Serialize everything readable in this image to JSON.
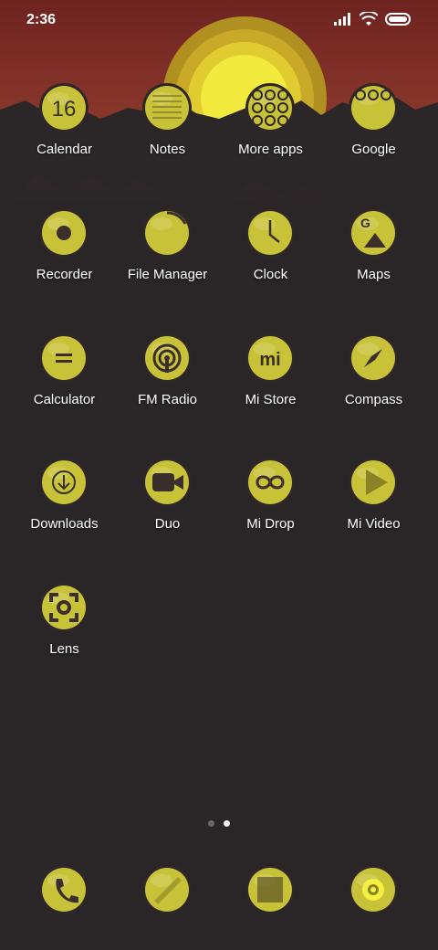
{
  "status": {
    "time": "2:36",
    "icons": [
      "signal-icon",
      "wifi-icon",
      "battery-icon"
    ]
  },
  "colors": {
    "accent": "#e8e640",
    "icon_fill": "#c8c238",
    "background": "#2a2527",
    "sky": "#8a2f2a"
  },
  "apps": [
    {
      "label": "Calendar",
      "icon": "calendar-icon",
      "text": "16"
    },
    {
      "label": "Notes",
      "icon": "notes-icon"
    },
    {
      "label": "More apps",
      "icon": "folder-icon"
    },
    {
      "label": "Google",
      "icon": "google-folder-icon"
    },
    {
      "label": "Recorder",
      "icon": "recorder-icon"
    },
    {
      "label": "File Manager",
      "icon": "file-manager-icon"
    },
    {
      "label": "Clock",
      "icon": "clock-icon"
    },
    {
      "label": "Maps",
      "icon": "maps-icon"
    },
    {
      "label": "Calculator",
      "icon": "calculator-icon"
    },
    {
      "label": "FM Radio",
      "icon": "radio-icon"
    },
    {
      "label": "Mi Store",
      "icon": "mi-store-icon"
    },
    {
      "label": "Compass",
      "icon": "compass-icon"
    },
    {
      "label": "Downloads",
      "icon": "download-icon"
    },
    {
      "label": "Duo",
      "icon": "video-camera-icon"
    },
    {
      "label": "Mi Drop",
      "icon": "infinity-icon"
    },
    {
      "label": "Mi Video",
      "icon": "play-icon"
    },
    {
      "label": "Lens",
      "icon": "lens-icon"
    }
  ],
  "pager": {
    "pages": 2,
    "active": 2
  },
  "dock": [
    {
      "icon": "phone-icon"
    },
    {
      "icon": "messages-icon"
    },
    {
      "icon": "gallery-icon"
    },
    {
      "icon": "camera-icon"
    }
  ]
}
